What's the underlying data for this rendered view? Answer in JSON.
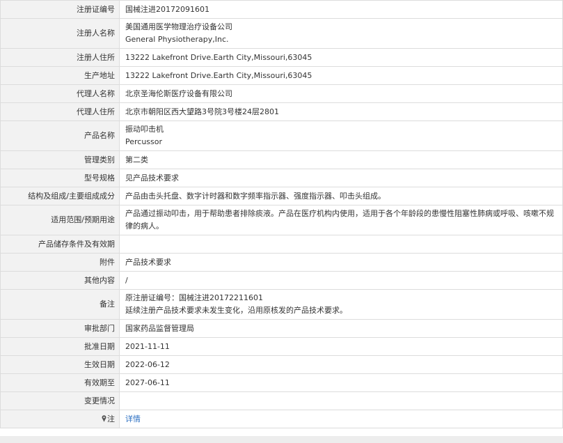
{
  "rows": [
    {
      "label": "注册证编号",
      "lines": [
        "国械注进20172091601"
      ]
    },
    {
      "label": "注册人名称",
      "lines": [
        "美国通用医学物理治疗设备公司",
        "General Physiotherapy,Inc."
      ]
    },
    {
      "label": "注册人住所",
      "lines": [
        "13222 Lakefront Drive.Earth City,Missouri,63045"
      ]
    },
    {
      "label": "生产地址",
      "lines": [
        "13222 Lakefront Drive.Earth City,Missouri,63045"
      ]
    },
    {
      "label": "代理人名称",
      "lines": [
        "北京圣海伦斯医疗设备有限公司"
      ]
    },
    {
      "label": "代理人住所",
      "lines": [
        "北京市朝阳区西大望路3号院3号楼24层2801"
      ]
    },
    {
      "label": "产品名称",
      "lines": [
        "振动叩击机",
        "Percussor"
      ]
    },
    {
      "label": "管理类别",
      "lines": [
        "第二类"
      ]
    },
    {
      "label": "型号规格",
      "lines": [
        "见产品技术要求"
      ]
    },
    {
      "label": "结构及组成/主要组成成分",
      "lines": [
        "产品由击头托盘、数字计时器和数字频率指示器、强度指示器、叩击头组成。"
      ]
    },
    {
      "label": "适用范围/预期用途",
      "lines": [
        "产品通过振动叩击，用于帮助患者排除痰液。产品在医疗机构内使用，适用于各个年龄段的患慢性阻塞性肺病或呼吸、咳嗽不规律的病人。"
      ]
    },
    {
      "label": "产品储存条件及有效期",
      "lines": []
    },
    {
      "label": "附件",
      "lines": [
        "产品技术要求"
      ]
    },
    {
      "label": "其他内容",
      "lines": [
        "/"
      ]
    },
    {
      "label": "备注",
      "lines": [
        "原注册证编号：国械注进20172211601",
        "延续注册产品技术要求未发生变化，沿用原核发的产品技术要求。"
      ]
    },
    {
      "label": "审批部门",
      "lines": [
        "国家药品监督管理局"
      ]
    },
    {
      "label": "批准日期",
      "lines": [
        "2021-11-11"
      ]
    },
    {
      "label": "生效日期",
      "lines": [
        "2022-06-12"
      ]
    },
    {
      "label": "有效期至",
      "lines": [
        "2027-06-11"
      ]
    },
    {
      "label": "变更情况",
      "lines": []
    }
  ],
  "note_row": {
    "label": "注",
    "icon": "pin-icon",
    "link_text": "详情",
    "link_color": "#2b6fc2"
  }
}
